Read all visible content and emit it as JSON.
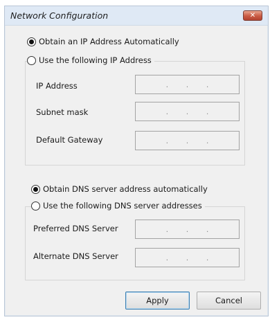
{
  "window": {
    "title": "Network Configuration",
    "close_glyph": "✕"
  },
  "ip": {
    "auto_label": "Obtain an IP Address Automatically",
    "manual_label": "Use the following IP Address",
    "fields": [
      {
        "label": "IP Address",
        "value": ""
      },
      {
        "label": "Subnet mask",
        "value": ""
      },
      {
        "label": "Default Gateway",
        "value": ""
      }
    ]
  },
  "dns": {
    "auto_label": "Obtain DNS server address automatically",
    "manual_label": "Use the following DNS server addresses",
    "fields": [
      {
        "label": "Preferred DNS Server",
        "value": ""
      },
      {
        "label": "Alternate DNS Server",
        "value": ""
      }
    ]
  },
  "buttons": {
    "apply": "Apply",
    "cancel": "Cancel"
  },
  "selected": {
    "ip_mode": "auto",
    "dns_mode": "auto"
  },
  "colors": {
    "titlebar": "#dfe9f5",
    "close": "#c95b43",
    "dialog_bg": "#f0f0f0"
  },
  "icons": {
    "close": "close-icon"
  }
}
